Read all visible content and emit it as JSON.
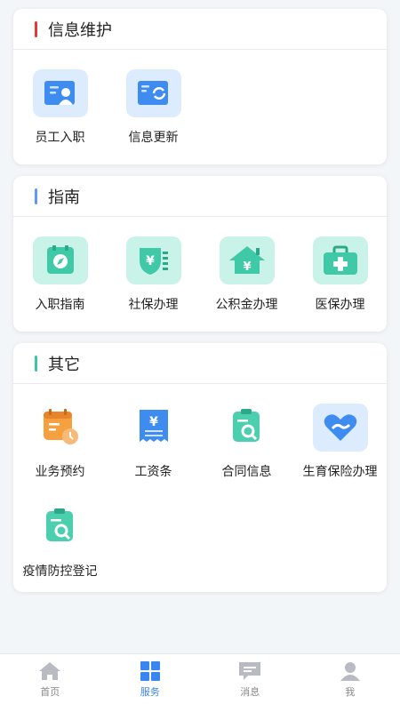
{
  "sections": {
    "info": {
      "title": "信息维护",
      "accent": "#e53935",
      "items": [
        {
          "label": "员工入职",
          "icon": "employee-card-icon"
        },
        {
          "label": "信息更新",
          "icon": "refresh-card-icon"
        }
      ]
    },
    "guide": {
      "title": "指南",
      "accent": "#5b9cf5",
      "items": [
        {
          "label": "入职指南",
          "icon": "compass-icon"
        },
        {
          "label": "社保办理",
          "icon": "social-security-icon"
        },
        {
          "label": "公积金办理",
          "icon": "housing-fund-icon"
        },
        {
          "label": "医保办理",
          "icon": "medical-kit-icon"
        }
      ]
    },
    "other": {
      "title": "其它",
      "accent": "#3cc6a8",
      "items": [
        {
          "label": "业务预约",
          "icon": "appointment-icon"
        },
        {
          "label": "工资条",
          "icon": "payslip-icon"
        },
        {
          "label": "合同信息",
          "icon": "contract-search-icon"
        },
        {
          "label": "生育保险办理",
          "icon": "heart-hand-icon"
        },
        {
          "label": "疫情防控登记",
          "icon": "epidemic-register-icon"
        }
      ]
    }
  },
  "bottom_nav": [
    {
      "label": "首页",
      "icon": "home-icon"
    },
    {
      "label": "服务",
      "icon": "grid-icon",
      "active": true
    },
    {
      "label": "消息",
      "icon": "message-icon"
    },
    {
      "label": "我",
      "icon": "user-icon"
    }
  ],
  "colors": {
    "active": "#3a86f0",
    "inactive": "#b8bcc2"
  }
}
